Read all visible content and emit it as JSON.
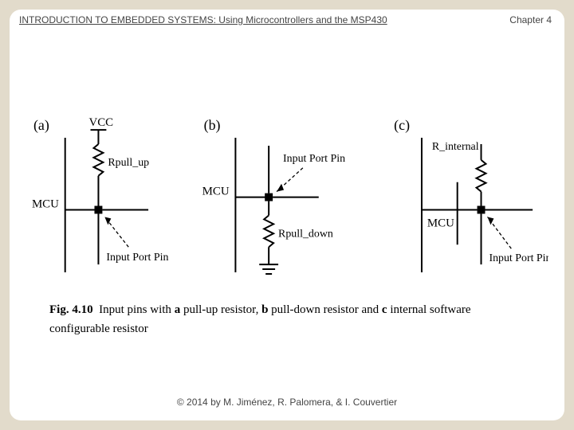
{
  "header": {
    "title": "INTRODUCTION TO EMBEDDED SYSTEMS: Using Microcontrollers and the MSP430",
    "chapter": "Chapter 4"
  },
  "footer": {
    "copyright": "© 2014 by M. Jiménez, R. Palomera, & I. Couvertier"
  },
  "figure": {
    "panels": {
      "a": {
        "tag": "(a)",
        "vcc": "VCC",
        "mcu": "MCU",
        "resistor": "Rpull_up",
        "pin": "Input Port Pin"
      },
      "b": {
        "tag": "(b)",
        "mcu": "MCU",
        "resistor": "Rpull_down",
        "pin": "Input Port Pin"
      },
      "c": {
        "tag": "(c)",
        "mcu": "MCU",
        "resistor": "R_internal",
        "pin": "Input Port Pin"
      }
    },
    "caption_label": "Fig. 4.10",
    "caption_t1": "Input pins with ",
    "caption_b1": "a",
    "caption_t2": " pull-up resistor, ",
    "caption_b2": "b",
    "caption_t3": " pull-down resistor and ",
    "caption_b3": "c",
    "caption_t4": " internal software configurable resistor"
  }
}
